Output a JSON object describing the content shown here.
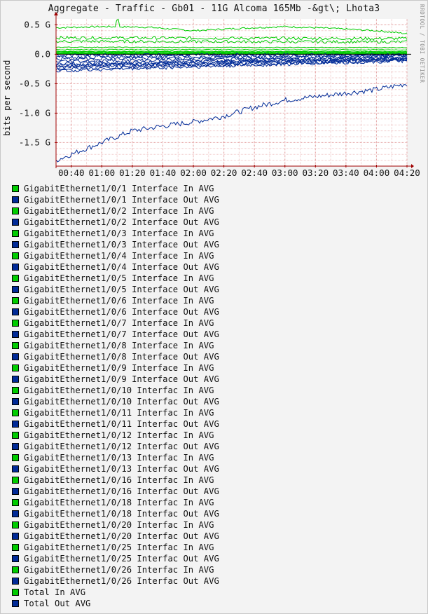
{
  "watermark": "RRDTOOL / TOBI OETIKER",
  "colors": {
    "in": "#00cc00",
    "out": "#002a97",
    "background": "#f3f3f3",
    "grid": "#e3a0a0",
    "axis": "#a00000"
  },
  "chart_data": {
    "type": "line",
    "title": "Aggregate - Traffic - Gb01 - 11G Alcoma 165Mb -&gt\\; Lhota3",
    "ylabel": "bits per second",
    "xlabel": "",
    "ylim": [
      -1.9,
      0.6
    ],
    "xlim": [
      "00:30",
      "04:20"
    ],
    "y_ticks": [
      {
        "v": 0.5,
        "label": "0.5 G"
      },
      {
        "v": 0.0,
        "label": "0.0"
      },
      {
        "v": -0.5,
        "label": "-0.5 G"
      },
      {
        "v": -1.0,
        "label": "-1.0 G"
      },
      {
        "v": -1.5,
        "label": "-1.5 G"
      }
    ],
    "x_ticks": [
      "00:40",
      "01:00",
      "01:20",
      "01:40",
      "02:00",
      "02:20",
      "02:40",
      "03:00",
      "03:20",
      "03:40",
      "04:00",
      "04:20"
    ],
    "grid": true,
    "series": [
      {
        "name": "Total In AVG",
        "color": "#00cc00",
        "x": [
          "00:30",
          "01:00",
          "01:30",
          "02:00",
          "02:30",
          "03:00",
          "03:30",
          "04:00",
          "04:20"
        ],
        "y": [
          0.45,
          0.47,
          0.46,
          0.4,
          0.44,
          0.47,
          0.44,
          0.4,
          0.35
        ]
      },
      {
        "name": "Total Out AVG",
        "color": "#002a97",
        "x": [
          "00:30",
          "00:45",
          "01:00",
          "01:20",
          "01:40",
          "02:00",
          "02:20",
          "02:40",
          "03:00",
          "03:20",
          "03:40",
          "04:00",
          "04:20"
        ],
        "y": [
          -1.8,
          -1.65,
          -1.5,
          -1.3,
          -1.22,
          -1.15,
          -1.05,
          -0.9,
          -0.78,
          -0.72,
          -0.66,
          -0.6,
          -0.5
        ]
      }
    ]
  },
  "legend": [
    {
      "label": "GigabitEthernet1/0/1 Interface In AVG",
      "color": "#00cc00"
    },
    {
      "label": "GigabitEthernet1/0/1 Interface Out AVG",
      "color": "#002a97"
    },
    {
      "label": "GigabitEthernet1/0/2 Interface In AVG",
      "color": "#00cc00"
    },
    {
      "label": "GigabitEthernet1/0/2 Interface Out AVG",
      "color": "#002a97"
    },
    {
      "label": "GigabitEthernet1/0/3 Interface In AVG",
      "color": "#00cc00"
    },
    {
      "label": "GigabitEthernet1/0/3 Interface Out AVG",
      "color": "#002a97"
    },
    {
      "label": "GigabitEthernet1/0/4 Interface In AVG",
      "color": "#00cc00"
    },
    {
      "label": "GigabitEthernet1/0/4 Interface Out AVG",
      "color": "#002a97"
    },
    {
      "label": "GigabitEthernet1/0/5 Interface In AVG",
      "color": "#00cc00"
    },
    {
      "label": "GigabitEthernet1/0/5 Interface Out AVG",
      "color": "#002a97"
    },
    {
      "label": "GigabitEthernet1/0/6 Interface In AVG",
      "color": "#00cc00"
    },
    {
      "label": "GigabitEthernet1/0/6 Interface Out AVG",
      "color": "#002a97"
    },
    {
      "label": "GigabitEthernet1/0/7 Interface In AVG",
      "color": "#00cc00"
    },
    {
      "label": "GigabitEthernet1/0/7 Interface Out AVG",
      "color": "#002a97"
    },
    {
      "label": "GigabitEthernet1/0/8 Interface In AVG",
      "color": "#00cc00"
    },
    {
      "label": "GigabitEthernet1/0/8 Interface Out AVG",
      "color": "#002a97"
    },
    {
      "label": "GigabitEthernet1/0/9 Interface In AVG",
      "color": "#00cc00"
    },
    {
      "label": "GigabitEthernet1/0/9 Interface Out AVG",
      "color": "#002a97"
    },
    {
      "label": "GigabitEthernet1/0/10 Interfac In AVG",
      "color": "#00cc00"
    },
    {
      "label": "GigabitEthernet1/0/10 Interfac Out AVG",
      "color": "#002a97"
    },
    {
      "label": "GigabitEthernet1/0/11 Interfac In AVG",
      "color": "#00cc00"
    },
    {
      "label": "GigabitEthernet1/0/11 Interfac Out AVG",
      "color": "#002a97"
    },
    {
      "label": "GigabitEthernet1/0/12 Interfac In AVG",
      "color": "#00cc00"
    },
    {
      "label": "GigabitEthernet1/0/12 Interfac Out AVG",
      "color": "#002a97"
    },
    {
      "label": "GigabitEthernet1/0/13 Interfac In AVG",
      "color": "#00cc00"
    },
    {
      "label": "GigabitEthernet1/0/13 Interfac Out AVG",
      "color": "#002a97"
    },
    {
      "label": "GigabitEthernet1/0/16 Interfac In AVG",
      "color": "#00cc00"
    },
    {
      "label": "GigabitEthernet1/0/16 Interfac Out AVG",
      "color": "#002a97"
    },
    {
      "label": "GigabitEthernet1/0/18 Interfac In AVG",
      "color": "#00cc00"
    },
    {
      "label": "GigabitEthernet1/0/18 Interfac Out AVG",
      "color": "#002a97"
    },
    {
      "label": "GigabitEthernet1/0/20 Interfac In AVG",
      "color": "#00cc00"
    },
    {
      "label": "GigabitEthernet1/0/20 Interfac Out AVG",
      "color": "#002a97"
    },
    {
      "label": "GigabitEthernet1/0/25 Interfac In AVG",
      "color": "#00cc00"
    },
    {
      "label": "GigabitEthernet1/0/25 Interfac Out AVG",
      "color": "#002a97"
    },
    {
      "label": "GigabitEthernet1/0/26 Interfac In AVG",
      "color": "#00cc00"
    },
    {
      "label": "GigabitEthernet1/0/26 Interfac Out AVG",
      "color": "#002a97"
    },
    {
      "label": "Total In AVG",
      "color": "#00cc00"
    },
    {
      "label": "Total Out AVG",
      "color": "#002a97"
    }
  ]
}
